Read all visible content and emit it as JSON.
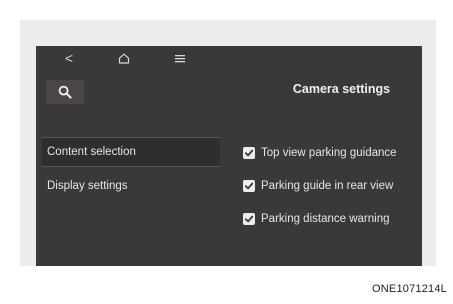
{
  "header": {
    "back_icon": "chevron-left-icon",
    "back_glyph": "<",
    "home_icon": "home-icon",
    "menu_icon": "menu-icon"
  },
  "sidebar": {
    "search_icon": "search-icon",
    "items": [
      {
        "label": "Content selection",
        "selected": true
      },
      {
        "label": "Display settings",
        "selected": false
      }
    ]
  },
  "main": {
    "title": "Camera settings",
    "options": [
      {
        "label": "Top view parking guidance",
        "checked": true
      },
      {
        "label": "Parking guide in rear view",
        "checked": true
      },
      {
        "label": "Parking distance warning",
        "checked": true
      }
    ]
  },
  "caption": "ONE1071214L",
  "colors": {
    "screen_background": "#3b3838",
    "text": "#e6e6e6",
    "checkbox": "#ececec"
  }
}
